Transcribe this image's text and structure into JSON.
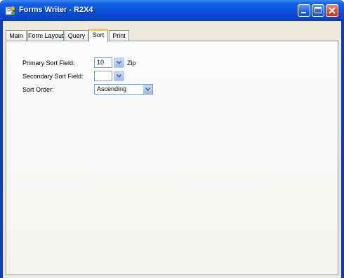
{
  "window": {
    "title": "Forms Writer - R2X4"
  },
  "tabs": [
    {
      "label": "Main",
      "active": false
    },
    {
      "label": "Form Layout",
      "active": false
    },
    {
      "label": "Query",
      "active": false
    },
    {
      "label": "Sort",
      "active": true
    },
    {
      "label": "Print",
      "active": false
    }
  ],
  "sort": {
    "primary_label": "Primary Sort Field:",
    "primary_value": "10",
    "primary_field_name": "Zip",
    "secondary_label": "Secondary Sort Field:",
    "secondary_value": "",
    "order_label": "Sort Order:",
    "order_value": "Ascending"
  },
  "colors": {
    "titlebar": "#0a50dc",
    "tab_highlight": "#ffc83c",
    "dialog_bg": "#ece9d8"
  },
  "icons": {
    "app": "forms-writer-app-icon",
    "minimize": "minimize-icon",
    "maximize": "maximize-icon",
    "close": "close-icon",
    "dropdown": "chevron-down-icon"
  }
}
